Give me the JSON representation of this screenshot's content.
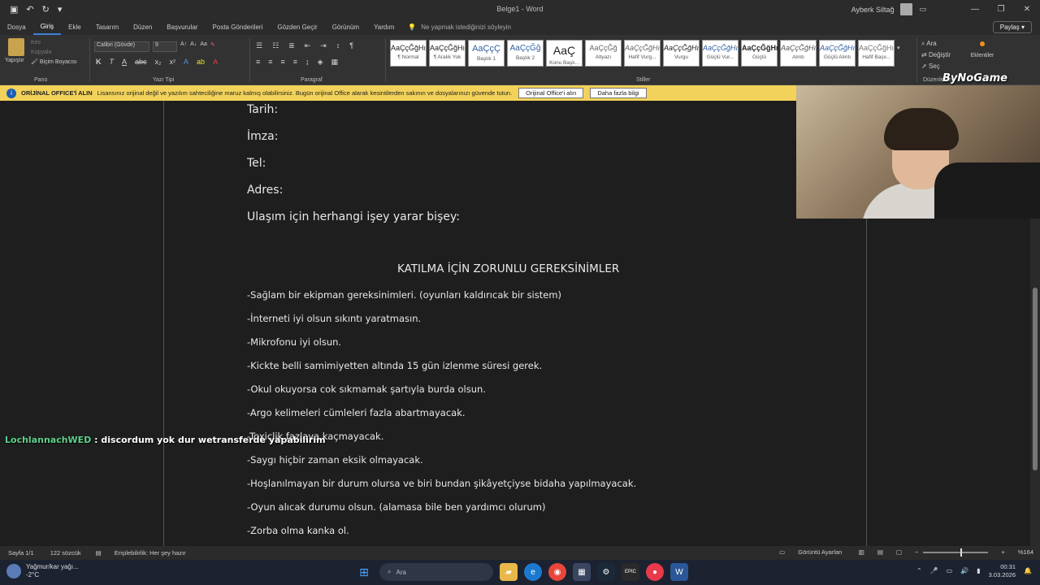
{
  "titlebar": {
    "doc_title": "Belge1 - Word",
    "user_name": "Ayberk Siltağ",
    "quick_access": [
      "save",
      "undo",
      "redo",
      "customize"
    ]
  },
  "menu": {
    "tabs": [
      "Dosya",
      "Giriş",
      "Ekle",
      "Tasarım",
      "Düzen",
      "Başvurular",
      "Posta Gönderileri",
      "Gözden Geçir",
      "Görünüm",
      "Yardım"
    ],
    "active_tab": "Giriş",
    "tell_me": "Ne yapmak istediğinizi söyleyin",
    "share": "Paylaş"
  },
  "ribbon": {
    "clipboard": {
      "paste": "Yapıştır",
      "cut": "Kes",
      "copy": "Kopyala",
      "format_painter": "Biçim Boyacısı",
      "label": "Pano"
    },
    "font": {
      "family": "Calibri (Gövde)",
      "size": "9",
      "label": "Yazı Tipi"
    },
    "paragraph": {
      "label": "Paragraf"
    },
    "styles": {
      "label": "Stiller",
      "items": [
        {
          "preview": "AaÇçĞğHı",
          "name": "¶ Normal"
        },
        {
          "preview": "AaÇçĞğHı",
          "name": "¶ Aralık Yok"
        },
        {
          "preview": "AaÇçÇ",
          "name": "Başlık 1"
        },
        {
          "preview": "AaÇçĞğ",
          "name": "Başlık 2"
        },
        {
          "preview": "AaÇ",
          "name": "Konu Başlı..."
        },
        {
          "preview": "AaÇçĞğ",
          "name": "Altyazı"
        },
        {
          "preview": "AaÇçĞğHı",
          "name": "Hafif Vurg..."
        },
        {
          "preview": "AaÇçĞğHı",
          "name": "Vurgu"
        },
        {
          "preview": "AaÇçĞğHı",
          "name": "Güçlü Vur..."
        },
        {
          "preview": "AaÇçĞğHı",
          "name": "Güçlü"
        },
        {
          "preview": "AaÇçĞğHı",
          "name": "Alıntı"
        },
        {
          "preview": "AaÇçĞğHı",
          "name": "Güçlü Alıntı"
        },
        {
          "preview": "AaÇçĞğHı",
          "name": "Hafif Başv..."
        }
      ]
    },
    "editing": {
      "find": "Ara",
      "replace": "Değiştir",
      "select": "Seç",
      "label": "Düzenleme"
    },
    "addins": {
      "label": "Eklentiler"
    }
  },
  "infobar": {
    "title": "ORİJİNAL OFFICE'İ ALIN",
    "message": "Lisansınız orijinal değil ve yazılım sahteciliğine maruz kalmış olabilirsiniz. Bugün orijinal Office alarak kesintilerden sakının ve dosyalarınızı güvende tutun.",
    "button1": "Orijinal Office'i alın",
    "button2": "Daha fazla bilgi"
  },
  "document": {
    "fields": [
      "Tarih:",
      "İmza:",
      "Tel:",
      "Adres:",
      "Ulaşım için herhangi işey yarar bişey:"
    ],
    "heading": "KATILMA İÇİN ZORUNLU GEREKSİNİMLER",
    "requirements": [
      "-Sağlam bir ekipman gereksinimleri. (oyunları kaldırıcak bir sistem)",
      "-İnterneti iyi olsun sıkıntı yaratmasın.",
      "-Mikrofonu iyi olsun.",
      "-Kickte belli samimiyetten altında 15 gün izlenme süresi gerek.",
      "-Okul okuyorsa cok sıkmamak şartıyla burda olsun.",
      "-Argo kelimeleri cümleleri fazla abartmayacak.",
      "-Toxiclik fazlaya kaçmayacak.",
      "-Saygı hiçbir zaman eksik olmayacak.",
      "-Hoşlanılmayan bir durum olursa ve biri bundan şikâyetçiyse bidaha yapılmayacak.",
      "-Oyun alıcak durumu olsun. (alamasa bile ben yardımcı olurum)",
      "-Zorba olma kanka ol."
    ]
  },
  "overlay": {
    "chat_nick": "LochlannachWED",
    "chat_message": " : discordum yok dur wetransferde yapabilirim",
    "watermark": "ByNoGame"
  },
  "status": {
    "page": "Sayfa 1/1",
    "words": "122 sözcük",
    "accessibility": "Erişilebilirlik: Her şey hazır",
    "display_settings": "Görüntü Ayarları",
    "zoom": "%164"
  },
  "taskbar": {
    "weather": "Yağmur/kar yağı...",
    "temp": "-2°C",
    "search": "Ara",
    "time": "00:31",
    "date": "3.03.2026"
  }
}
